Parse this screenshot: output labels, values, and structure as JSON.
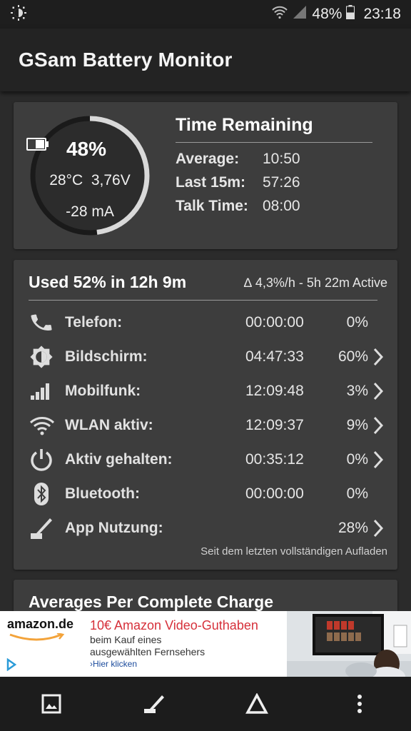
{
  "status_bar": {
    "battery_percent": "48%",
    "time": "23:18",
    "icons": [
      "brightness-icon",
      "wifi-icon",
      "signal-icon",
      "battery-icon"
    ]
  },
  "app": {
    "title": "GSam Battery Monitor"
  },
  "battery": {
    "percent": "48%",
    "level": 0.48,
    "temperature": "28°C",
    "voltage": "3,76V",
    "current": "-28 mA"
  },
  "time_remaining": {
    "title": "Time Remaining",
    "rows": [
      {
        "label": "Average:",
        "value": "10:50"
      },
      {
        "label": "Last 15m:",
        "value": "57:26"
      },
      {
        "label": "Talk Time:",
        "value": "08:00"
      }
    ]
  },
  "usage": {
    "title": "Used 52% in 12h 9m",
    "rate": "∆ 4,3%/h - 5h 22m Active",
    "rows": [
      {
        "icon": "phone-icon",
        "label": "Telefon:",
        "time": "00:00:00",
        "percent": "0%",
        "has_detail": false
      },
      {
        "icon": "screen-brightness-icon",
        "label": "Bildschirm:",
        "time": "04:47:33",
        "percent": "60%",
        "has_detail": true
      },
      {
        "icon": "cell-signal-icon",
        "label": "Mobilfunk:",
        "time": "12:09:48",
        "percent": "3%",
        "has_detail": true
      },
      {
        "icon": "wifi-icon",
        "label": "WLAN aktiv:",
        "time": "12:09:37",
        "percent": "9%",
        "has_detail": true
      },
      {
        "icon": "power-icon",
        "label": "Aktiv gehalten:",
        "time": "00:35:12",
        "percent": "0%",
        "has_detail": true
      },
      {
        "icon": "bluetooth-icon",
        "label": "Bluetooth:",
        "time": "00:00:00",
        "percent": "0%",
        "has_detail": false
      },
      {
        "icon": "app-usage-icon",
        "label": "App Nutzung:",
        "time": "",
        "percent": "28%",
        "has_detail": true
      }
    ],
    "footnote": "Seit dem letzten vollständigen Aufladen"
  },
  "averages": {
    "title": "Averages Per Complete Charge"
  },
  "ad": {
    "brand": "amazon.de",
    "headline": "10€ Amazon Video-Guthaben",
    "line1": "beim Kauf eines",
    "line2": "ausgewählten Fernsehers",
    "link": "›Hier klicken"
  },
  "nav": {
    "items": [
      "image-icon",
      "app-usage-icon",
      "delta-icon",
      "more-vert-icon"
    ]
  },
  "colors": {
    "background": "#2b2b2b",
    "card": "#3d3d3d",
    "ad_headline": "#d6303a"
  }
}
